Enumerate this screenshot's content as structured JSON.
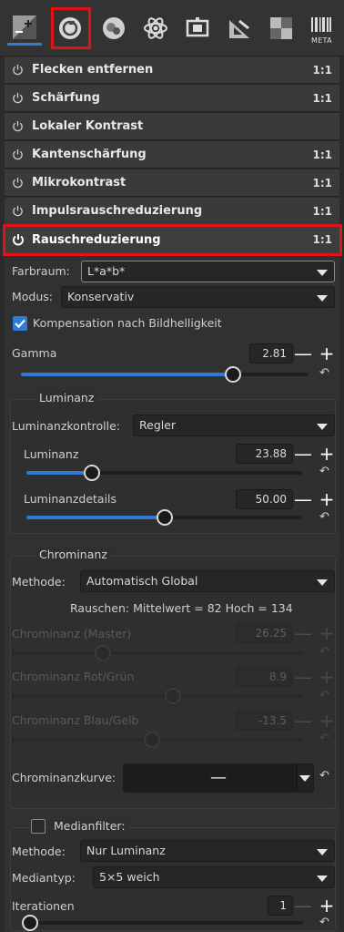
{
  "toolbar": {
    "tabs": [
      {
        "name": "exposure-tab-icon"
      },
      {
        "name": "detail-tab-icon"
      },
      {
        "name": "color-tab-icon"
      },
      {
        "name": "advanced-tab-icon"
      },
      {
        "name": "transform-tab-icon"
      },
      {
        "name": "raw-tab-icon"
      },
      {
        "name": "filmstrip-tab-icon"
      },
      {
        "name": "meta-tab-icon",
        "label": "META"
      }
    ],
    "meta_label": "META",
    "highlight_color": "#e01414",
    "accent_color": "#2e7fd8"
  },
  "tools": [
    {
      "label": "Flecken entfernen",
      "ratio": "1:1"
    },
    {
      "label": "Schärfung",
      "ratio": "1:1"
    },
    {
      "label": "Lokaler Kontrast",
      "ratio": ""
    },
    {
      "label": "Kantenschärfung",
      "ratio": "1:1"
    },
    {
      "label": "Mikrokontrast",
      "ratio": "1:1"
    },
    {
      "label": "Impulsrauschreduzierung",
      "ratio": "1:1"
    },
    {
      "label": "Rauschreduzierung",
      "ratio": "1:1"
    }
  ],
  "noise": {
    "farbraum_label": "Farbraum:",
    "farbraum_value": "L*a*b*",
    "modus_label": "Modus:",
    "modus_value": "Konservativ",
    "kompensation_label": "Kompensation nach Bildhelligkeit",
    "kompensation_checked": true,
    "gamma_label": "Gamma",
    "gamma_value": "2.81",
    "gamma_level": 0.74
  },
  "luminanz": {
    "title": "Luminanz",
    "kontrolle_label": "Luminanzkontrolle:",
    "kontrolle_value": "Regler",
    "luminanz_label": "Luminanz",
    "luminanz_value": "23.88",
    "luminanz_level": 0.2388,
    "details_label": "Luminanzdetails",
    "details_value": "50.00",
    "details_level": 0.5
  },
  "chrominanz": {
    "title": "Chrominanz",
    "methode_label": "Methode:",
    "methode_value": "Automatisch Global",
    "rauschen_text": "Rauschen: Mittelwert = 82  Hoch = 134",
    "master_label": "Chrominanz (Master)",
    "master_value": "26.25",
    "rotgruen_label": "Chrominanz Rot/Grün",
    "rotgruen_value": "8.9",
    "blaugelb_label": "Chrominanz Blau/Gelb",
    "blaugelb_value": "-13.5",
    "kurve_label": "Chrominanzkurve:",
    "kurve_value": "—"
  },
  "median": {
    "title": "Medianfilter:",
    "checked": false,
    "methode_label": "Methode:",
    "methode_value": "Nur Luminanz",
    "typ_label": "Mediantyp:",
    "typ_value": "5×5 weich",
    "iter_label": "Iterationen",
    "iter_value": "1"
  },
  "symbols": {
    "minus": "—",
    "plus": "+",
    "reset": "↶",
    "power": "⏻"
  }
}
